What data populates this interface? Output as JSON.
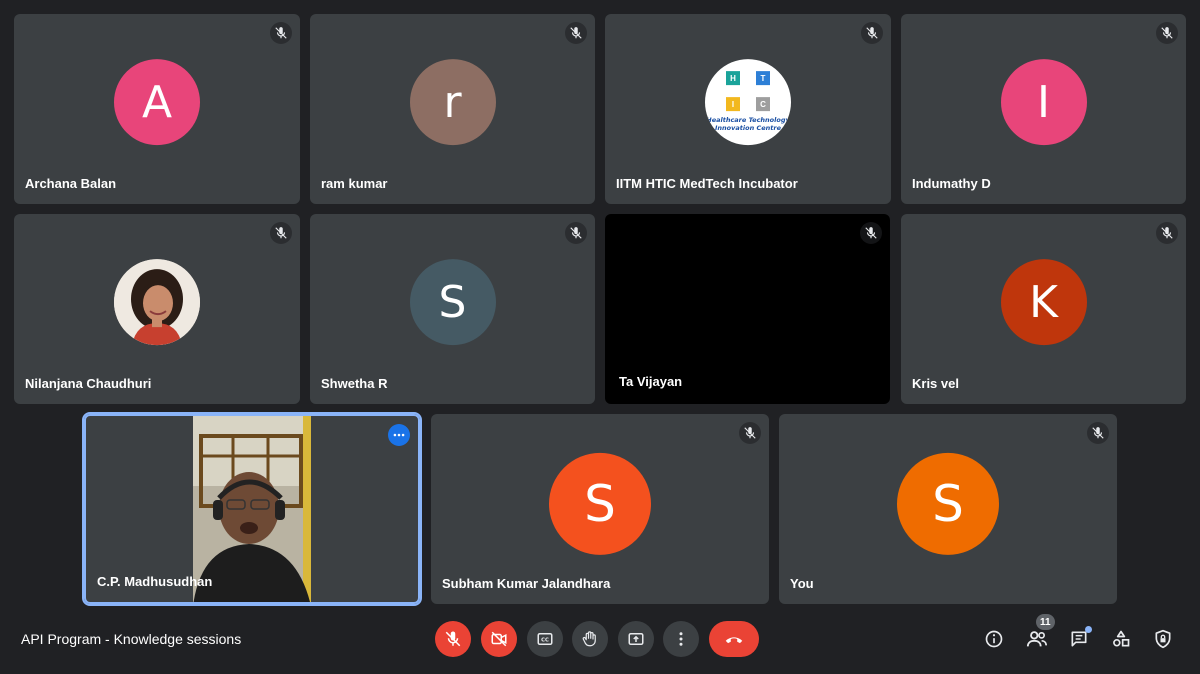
{
  "participants": [
    {
      "name": "Archana Balan",
      "initial": "A",
      "color": "#e8457a"
    },
    {
      "name": "ram kumar",
      "initial": "r",
      "color": "#8d6e63"
    },
    {
      "name": "IITM HTIC MedTech Incubator",
      "initial": "",
      "color": "#ffffff",
      "logo": {
        "cells": [
          "H",
          "T",
          "I",
          "C"
        ],
        "text_line1": "Healthcare Technology",
        "text_line2": "Innovation Centre"
      }
    },
    {
      "name": "Indumathy D",
      "initial": "I",
      "color": "#e8457a"
    },
    {
      "name": "Nilanjana Chaudhuri",
      "initial": "",
      "color": "#e6e0d8"
    },
    {
      "name": "Shwetha R",
      "initial": "S",
      "color": "#455a64"
    },
    {
      "name": "Ta Vijayan",
      "initial": "",
      "color": "#000000"
    },
    {
      "name": "Kris vel",
      "initial": "K",
      "color": "#bf360c"
    },
    {
      "name": "C.P. Madhusudhan",
      "initial": "",
      "color": "#3c4043"
    },
    {
      "name": "Subham Kumar Jalandhara",
      "initial": "S",
      "color": "#f4511e"
    },
    {
      "name": "You",
      "initial": "S",
      "color": "#ef6c00"
    }
  ],
  "bottom_bar": {
    "meeting_title": "API Program - Knowledge sessions",
    "participant_count": "11",
    "mic_state": "muted",
    "camera_state": "off"
  },
  "colors": {
    "background": "#202124",
    "tile": "#3c4043",
    "danger": "#ea4335",
    "active_outline": "#8ab4f8"
  }
}
